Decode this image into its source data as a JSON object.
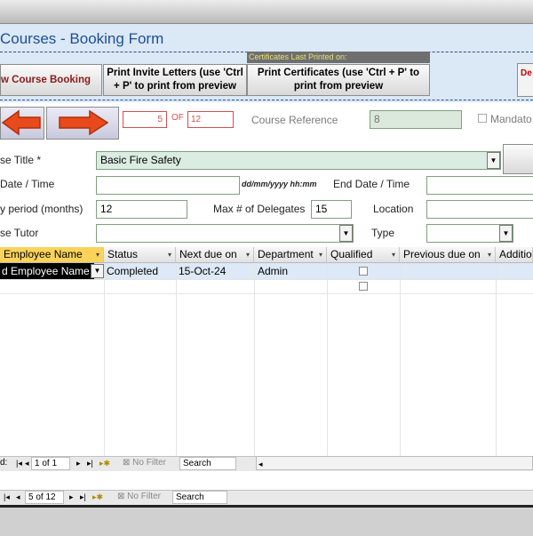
{
  "form": {
    "title": "Courses - Booking Form"
  },
  "toolbar": {
    "new_booking_label": "w Course Booking",
    "print_invites_line1": "Print Invite Letters (use 'Ctrl",
    "print_invites_line2": "+ P' to print from preview",
    "certs_printed_label": "Certificates Last Printed on:",
    "print_certs_line1": "Print Certificates (use 'Ctrl + P' to",
    "print_certs_line2": "print from preview",
    "delete_label": "De"
  },
  "record_nav": {
    "current": "5",
    "of_label": "OF",
    "total": "12"
  },
  "fields": {
    "course_reference_label": "Course Reference",
    "course_reference_value": "8",
    "mandatory_label": "Mandato",
    "course_title_label": "se Title *",
    "course_title_value": "Basic Fire Safety",
    "start_label": "Date / Time",
    "date_format_hint": "dd/mm/yyyy hh:mm",
    "end_label": "End Date / Time",
    "validity_label": "y period (months)",
    "validity_value": "12",
    "max_delegates_label": "Max # of Delegates",
    "max_delegates_value": "15",
    "location_label": "Location",
    "tutor_label": "se Tutor",
    "type_label": "Type"
  },
  "grid": {
    "headers": [
      "Employee Name",
      "Status",
      "Next due on",
      "Department",
      "Qualified",
      "Previous due on",
      "Additio"
    ],
    "row": {
      "employee": "d Employee Name",
      "status": "Completed",
      "next_due": "15-Oct-24",
      "department": "Admin"
    }
  },
  "subform_nav": {
    "record_label": "d:",
    "position": "1 of 1",
    "filter": "No Filter",
    "search": "Search"
  },
  "main_nav": {
    "position": "5 of 12",
    "filter": "No Filter",
    "search": "Search"
  }
}
